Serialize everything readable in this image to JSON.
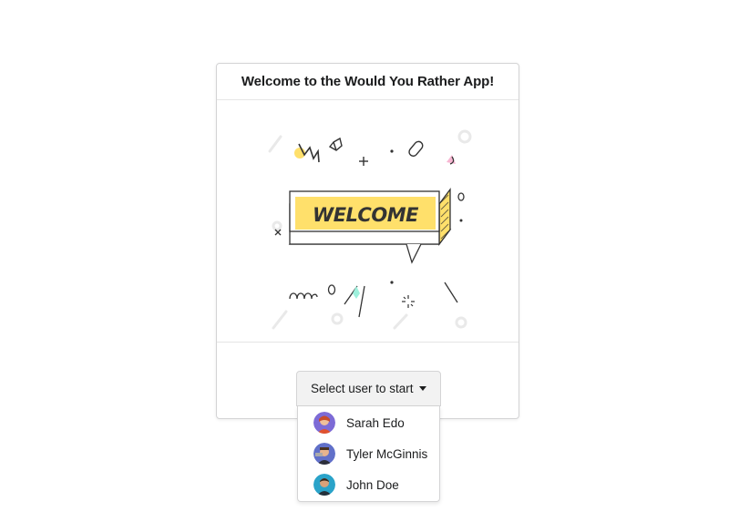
{
  "card": {
    "title": "Welcome to the Would You Rather App!",
    "banner_text": "WELCOME",
    "banner_color": "#ffe06b"
  },
  "user_select": {
    "placeholder": "Select user to start",
    "options": [
      {
        "name": "Sarah Edo",
        "avatar": "avatar-sarah-icon"
      },
      {
        "name": "Tyler McGinnis",
        "avatar": "avatar-tyler-icon"
      },
      {
        "name": "John Doe",
        "avatar": "avatar-john-icon"
      }
    ]
  }
}
